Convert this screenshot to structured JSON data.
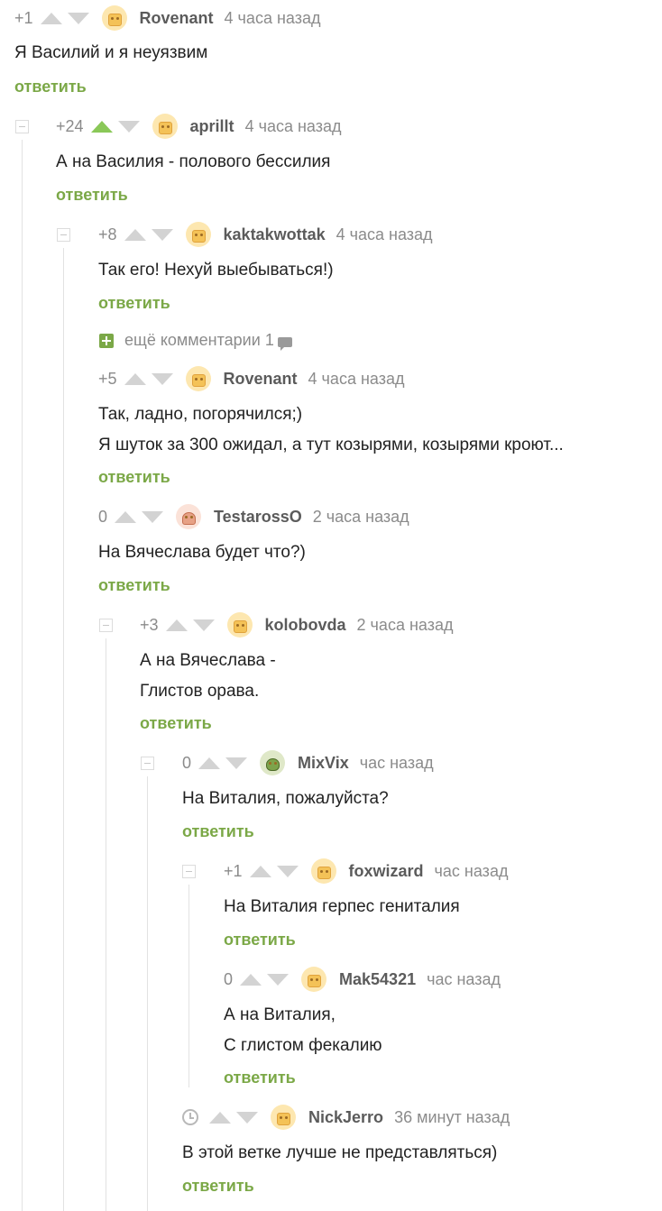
{
  "comments": [
    {
      "rating": "+1",
      "user": "Rovenant",
      "time": "4 часа назад",
      "lines": [
        "Я Василий и я неуязвим"
      ],
      "reply": "ответить"
    },
    {
      "rating": "+24",
      "user": "aprillt",
      "time": "4 часа назад",
      "lines": [
        "А на Василия - полового бессилия"
      ],
      "reply": "ответить"
    },
    {
      "rating": "+8",
      "user": "kaktakwottak",
      "time": "4 часа назад",
      "lines": [
        "Так его! Нехуй выебываться!)"
      ],
      "reply": "ответить"
    },
    {
      "rating": "+5",
      "user": "Rovenant",
      "time": "4 часа назад",
      "lines": [
        "Так, ладно, погорячился;)",
        "Я шуток за 300 ожидал, а тут козырями, козырями кроют..."
      ],
      "reply": "ответить"
    },
    {
      "rating": "0",
      "user": "TestarossO",
      "time": "2 часа назад",
      "lines": [
        "На Вячеслава будет что?)"
      ],
      "reply": "ответить"
    },
    {
      "rating": "+3",
      "user": "kolobovda",
      "time": "2 часа назад",
      "lines": [
        "А на Вячеслава -",
        "Глистов орава."
      ],
      "reply": "ответить"
    },
    {
      "rating": "0",
      "user": "MixVix",
      "time": "час назад",
      "lines": [
        "На Виталия, пожалуйста?"
      ],
      "reply": "ответить"
    },
    {
      "rating": "+1",
      "user": "foxwizard",
      "time": "час назад",
      "lines": [
        "На Виталия герпес гениталия"
      ],
      "reply": "ответить"
    },
    {
      "rating": "0",
      "user": "Mak54321",
      "time": "час назад",
      "lines": [
        "А на Виталия,",
        "С глистом фекалию"
      ],
      "reply": "ответить"
    },
    {
      "rating": "",
      "user": "NickJerro",
      "time": "36 минут назад",
      "lines": [
        "В этой ветке лучше не представляться)"
      ],
      "reply": "ответить"
    }
  ],
  "more_comments": {
    "label": "ещё комментарии",
    "count": "1"
  },
  "colors": {
    "accent_green": "#7ba847",
    "upvote_active": "#8ac858",
    "muted": "#8b8b8b"
  }
}
